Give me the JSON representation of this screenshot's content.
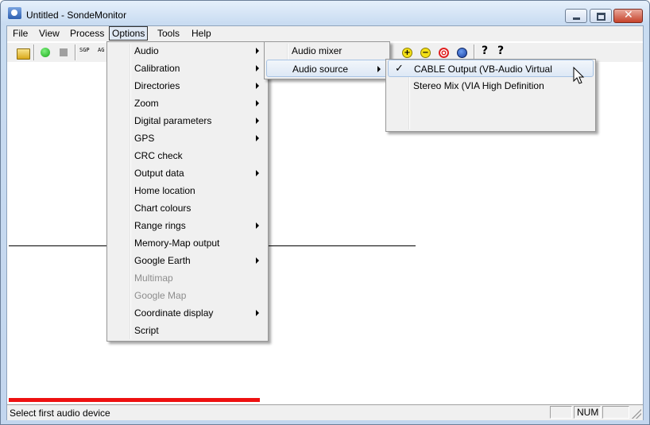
{
  "window": {
    "title": "Untitled - SondeMonitor",
    "close_glyph": "✕"
  },
  "menubar": {
    "items": [
      "File",
      "View",
      "Process",
      "Options",
      "Tools",
      "Help"
    ]
  },
  "toolbar": {
    "text_buttons": [
      "SGP",
      "AG"
    ],
    "icons": [
      "open-folder-icon",
      "start-icon",
      "stop-icon",
      "sgp-icon",
      "ag-icon",
      "zoom-in-icon",
      "zoom-out-icon",
      "target-icon",
      "compass-icon",
      "help-icon",
      "context-help-icon"
    ],
    "help_glyph": "?",
    "plus_glyph": "+",
    "minus_glyph": "−"
  },
  "options_menu": {
    "items": [
      {
        "label": "Audio",
        "submenu": true,
        "highlighted": false,
        "disabled": false
      },
      {
        "label": "Calibration",
        "submenu": true,
        "disabled": false
      },
      {
        "label": "Directories",
        "submenu": true,
        "disabled": false
      },
      {
        "label": "Zoom",
        "submenu": true,
        "disabled": false
      },
      {
        "label": "Digital parameters",
        "submenu": true,
        "disabled": false
      },
      {
        "label": "GPS",
        "submenu": true,
        "disabled": false
      },
      {
        "label": "CRC check",
        "submenu": false,
        "disabled": false
      },
      {
        "label": "Output data",
        "submenu": true,
        "disabled": false
      },
      {
        "label": "Home location",
        "submenu": false,
        "disabled": false
      },
      {
        "label": "Chart colours",
        "submenu": false,
        "disabled": false
      },
      {
        "label": "Range rings",
        "submenu": true,
        "disabled": false
      },
      {
        "label": "Memory-Map output",
        "submenu": false,
        "disabled": false
      },
      {
        "label": "Google Earth",
        "submenu": true,
        "disabled": false
      },
      {
        "label": "Multimap",
        "submenu": false,
        "disabled": true
      },
      {
        "label": "Google Map",
        "submenu": false,
        "disabled": true
      },
      {
        "label": "Coordinate display",
        "submenu": true,
        "disabled": false
      },
      {
        "label": "Script",
        "submenu": false,
        "disabled": false
      }
    ]
  },
  "audio_menu": {
    "items": [
      {
        "label": "Audio mixer",
        "submenu": false,
        "highlighted": false
      },
      {
        "label": "Audio source",
        "submenu": true,
        "highlighted": true
      }
    ]
  },
  "audio_source_menu": {
    "items": [
      {
        "label": "CABLE Output (VB-Audio Virtual",
        "checked": true,
        "highlighted": true
      },
      {
        "label": "Stereo Mix (VIA High Definition",
        "checked": false,
        "highlighted": false
      }
    ],
    "check_glyph": "✓"
  },
  "statusbar": {
    "text": "Select first audio device",
    "panes": [
      "",
      "NUM",
      ""
    ]
  },
  "colors": {
    "accent_red": "#ee1111",
    "menu_highlight": "#dde8f5"
  }
}
